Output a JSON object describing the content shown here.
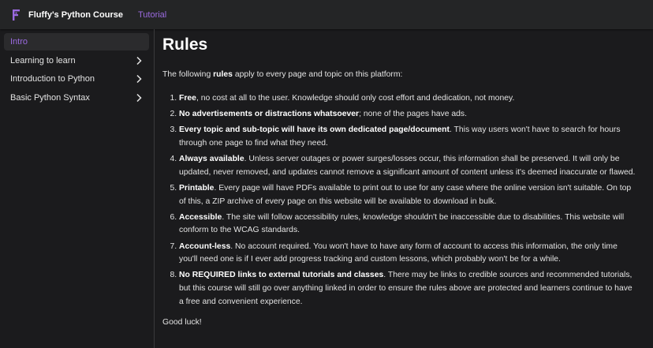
{
  "navbar": {
    "brand": "Fluffy's Python Course",
    "tutorial_link": "Tutorial",
    "accent_color": "#9b6ae0"
  },
  "sidebar": {
    "items": [
      {
        "label": "Intro",
        "active": true
      },
      {
        "label": "Learning to learn",
        "expandable": true
      },
      {
        "label": "Introduction to Python",
        "expandable": true
      },
      {
        "label": "Basic Python Syntax",
        "expandable": true
      }
    ]
  },
  "main": {
    "title": "Rules",
    "intro_before": "The following ",
    "intro_bold": "rules",
    "intro_after": " apply to every page and topic on this platform:",
    "rules": [
      {
        "bold": "Free",
        "text": ", no cost at all to the user. Knowledge should only cost effort and dedication, not money."
      },
      {
        "bold": "No advertisements or distractions whatsoever",
        "text": "; none of the pages have ads."
      },
      {
        "bold": "Every topic and sub-topic will have its own dedicated page/document",
        "text": ". This way users won't have to search for hours through one page to find what they need."
      },
      {
        "bold": "Always available",
        "text": ". Unless server outages or power surges/losses occur, this information shall be preserved. It will only be updated, never removed, and updates cannot remove a significant amount of content unless it's deemed inaccurate or flawed."
      },
      {
        "bold": "Printable",
        "text": ". Every page will have PDFs available to print out to use for any case where the online version isn't suitable. On top of this, a ZIP archive of every page on this website will be available to download in bulk."
      },
      {
        "bold": "Accessible",
        "text": ". The site will follow accessibility rules, knowledge shouldn't be inaccessible due to disabilities. This website will conform to the WCAG standards."
      },
      {
        "bold": "Account-less",
        "text": ". No account required. You won't have to have any form of account to access this information, the only time you'll need one is if I ever add progress tracking and custom lessons, which probably won't be for a while."
      },
      {
        "bold": "No REQUIRED links to external tutorials and classes",
        "text": ". There may be links to credible sources and recommended tutorials, but this course will still go over anything linked in order to ensure the rules above are protected and learners continue to have a free and convenient experience."
      }
    ],
    "outro": "Good luck!"
  }
}
